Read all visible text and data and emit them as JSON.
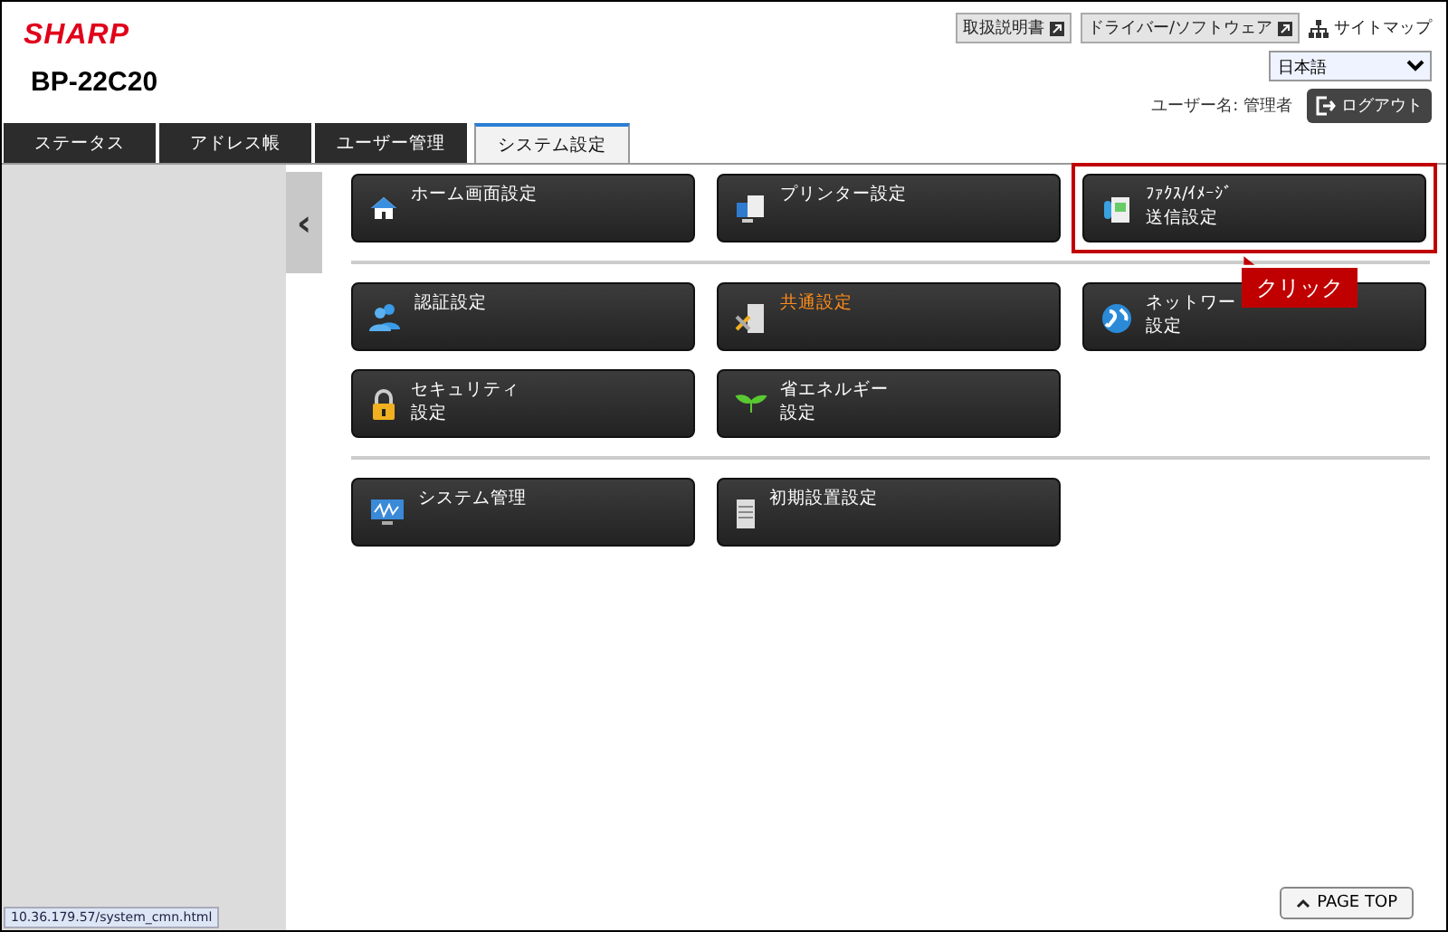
{
  "header": {
    "logo": "SHARP",
    "model": "BP-22C20",
    "links": [
      {
        "label": "取扱説明書",
        "kind": "external"
      },
      {
        "label": "ドライバー/ソフトウェア",
        "kind": "external"
      },
      {
        "label": "サイトマップ",
        "kind": "sitemap"
      }
    ],
    "language": "日本語",
    "user_label": "ユーザー名: 管理者",
    "logout": "ログアウト"
  },
  "tabs": [
    {
      "label": "ステータス",
      "selected": false
    },
    {
      "label": "アドレス帳",
      "selected": false
    },
    {
      "label": "ユーザー管理",
      "selected": false
    },
    {
      "label": "システム設定",
      "selected": true
    }
  ],
  "sidebar": {
    "collapse": "‹"
  },
  "sections": [
    {
      "items": [
        {
          "lines": [
            "ホーム画面設定"
          ],
          "kind": "home",
          "selected": false
        },
        {
          "lines": [
            "プリンター設定"
          ],
          "kind": "printer",
          "selected": false
        },
        {
          "lines": [
            "ﾌｧｸｽ/ｲﾒｰｼﾞ",
            "送信設定"
          ],
          "kind": "fax",
          "selected": false,
          "highlighted": true,
          "callout": "クリック"
        }
      ]
    },
    {
      "items": [
        {
          "lines": [
            "認証設定"
          ],
          "kind": "users",
          "selected": false
        },
        {
          "lines": [
            "共通設定"
          ],
          "kind": "tools",
          "selected": true
        },
        {
          "lines": [
            "ネットワー",
            "設定"
          ],
          "kind": "globe",
          "selected": false
        },
        {
          "lines": [
            "セキュリティ",
            "設定"
          ],
          "kind": "lock",
          "selected": false
        },
        {
          "lines": [
            "省エネルギー",
            "設定"
          ],
          "kind": "leaf",
          "selected": false
        }
      ]
    },
    {
      "items": [
        {
          "lines": [
            "システム管理"
          ],
          "kind": "monitor",
          "selected": false
        },
        {
          "lines": [
            "初期設置設定"
          ],
          "kind": "server",
          "selected": false
        }
      ]
    }
  ],
  "page_top": "PAGE TOP",
  "status_url": "10.36.179.57/system_cmn.html"
}
